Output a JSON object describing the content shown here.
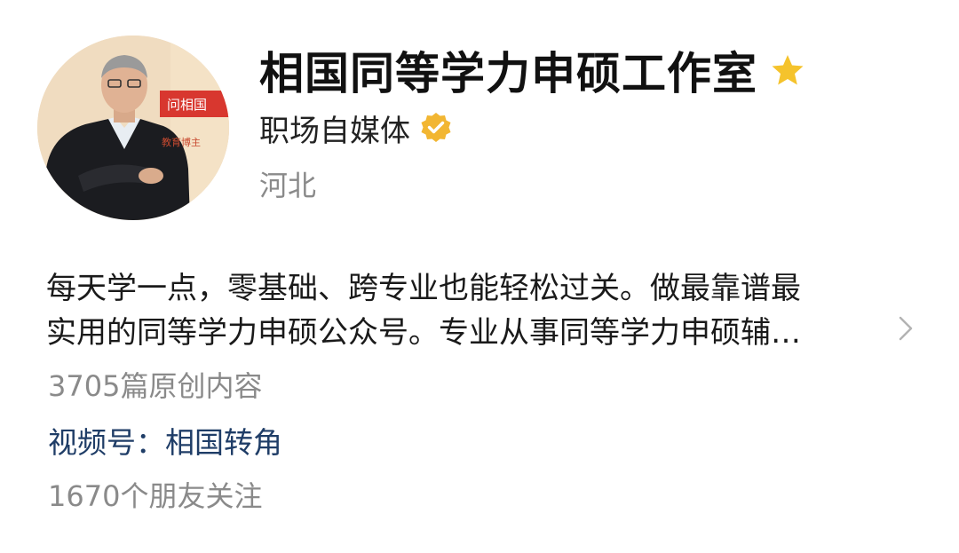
{
  "profile": {
    "name": "相国同等学力申硕工作室",
    "category": "职场自媒体",
    "location": "河北",
    "bio_line1": "每天学一点，零基础、跨专业也能轻松过关。做最靠谱最",
    "bio_line2": "实用的同等学力申硕公众号。专业从事同等学力申硕辅…",
    "articles": "3705篇原创内容",
    "channel_label": "视频号：",
    "channel_name": "相国转角",
    "followers": "1670个朋友关注"
  },
  "avatar": {
    "banner_text": "问相国",
    "tag_text": "教育博主"
  },
  "icons": {
    "star": "star-icon",
    "verified": "verified-badge-icon",
    "chevron": "chevron-right-icon"
  },
  "colors": {
    "star": "#f5c32c",
    "verified": "#f2b632",
    "channel_link": "#1f3d67",
    "muted_text": "#8a8a8a",
    "banner_red": "#d8372f"
  }
}
